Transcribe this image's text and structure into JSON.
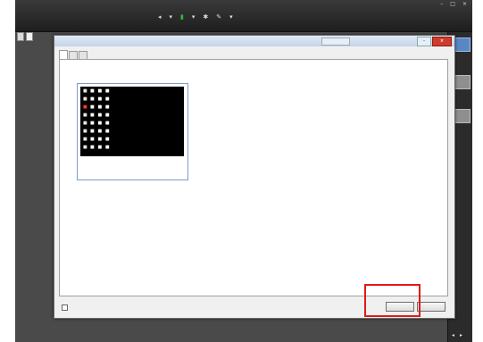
{
  "app": {
    "logo": "",
    "title": "",
    "menu": [
      "",
      "",
      "",
      ""
    ],
    "right_tool_label": "",
    "left_tool_label": ""
  },
  "tabs": [
    "",
    ""
  ],
  "right_panel": {
    "labels": [
      "",
      "",
      ""
    ]
  },
  "dialog": {
    "title": "",
    "tabs": [
      "",
      "",
      ""
    ],
    "preview_caption": "",
    "checkbox_label": "",
    "primary_button": "",
    "second_button": ""
  },
  "colors": {
    "highlight": "#e01919",
    "close_button": "#cf3c2d",
    "accent_icon": "#2fbf3a"
  }
}
